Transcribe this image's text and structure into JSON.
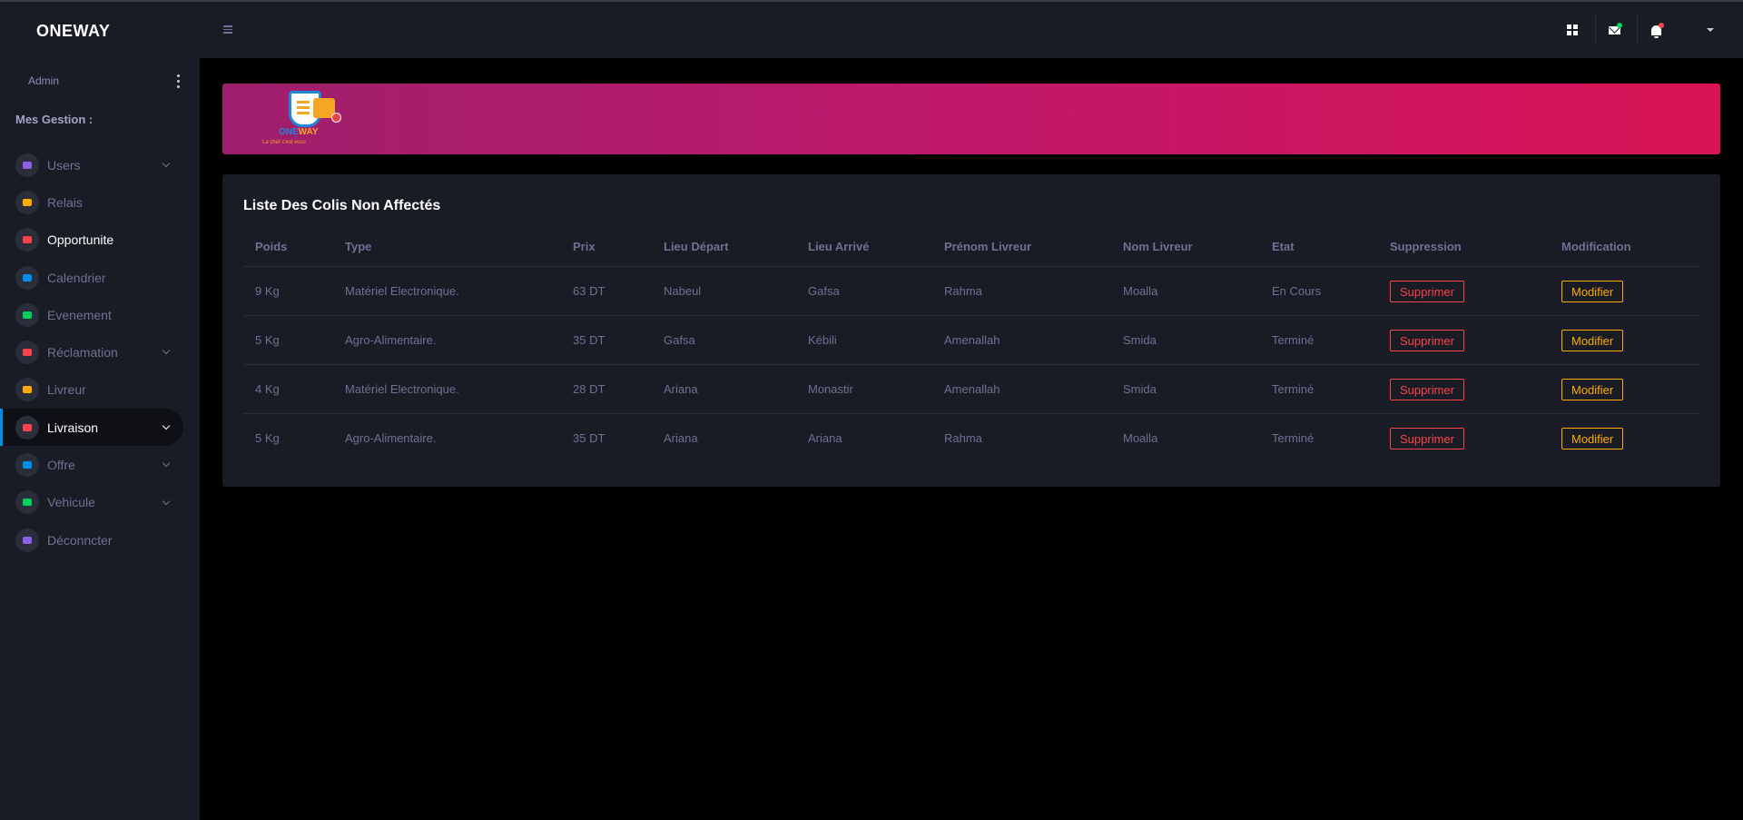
{
  "brand": "ONEWAY",
  "sidebar": {
    "admin_name": "Admin",
    "section_title": "Mes Gestion :",
    "items": [
      {
        "label": "Users",
        "icon": "users-icon",
        "color": "#8f5fe8",
        "chevron": true
      },
      {
        "label": "Relais",
        "icon": "table-icon",
        "color": "#ffab00",
        "chevron": false
      },
      {
        "label": "Opportunite",
        "icon": "message-icon",
        "color": "#fc424a",
        "chevron": false
      },
      {
        "label": "Calendrier",
        "icon": "list-icon",
        "color": "#0090e7",
        "chevron": false
      },
      {
        "label": "Evenement",
        "icon": "grid-icon",
        "color": "#00d25b",
        "chevron": false
      },
      {
        "label": "Réclamation",
        "icon": "file-icon",
        "color": "#fc424a",
        "chevron": true
      },
      {
        "label": "Livreur",
        "icon": "id-card-icon",
        "color": "#ffab00",
        "chevron": false
      },
      {
        "label": "Livraison",
        "icon": "truck-icon",
        "color": "#fc424a",
        "chevron": true,
        "active": true
      },
      {
        "label": "Offre",
        "icon": "tag-icon",
        "color": "#0090e7",
        "chevron": true
      },
      {
        "label": "Vehicule",
        "icon": "truck-icon",
        "color": "#00d25b",
        "chevron": true
      },
      {
        "label": "Déconncter",
        "icon": "contact-icon",
        "color": "#8f5fe8",
        "chevron": false
      }
    ]
  },
  "topbar": {
    "mail_dot_color": "#00d25b",
    "bell_dot_color": "#fc424a"
  },
  "banner": {
    "logo_text_one": "ONE",
    "logo_text_way": "WAY",
    "logo_slogan": "La chef c'est vous"
  },
  "table": {
    "title": "Liste Des Colis Non Affectés",
    "columns": [
      "Poids",
      "Type",
      "Prix",
      "Lieu Départ",
      "Lieu Arrivé",
      "Prénom Livreur",
      "Nom Livreur",
      "Etat",
      "Suppression",
      "Modification"
    ],
    "rows": [
      [
        "9 Kg",
        "Matériel Electronique.",
        "63 DT",
        "Nabeul",
        "Gafsa",
        "Rahma",
        "Moalla",
        "En Cours"
      ],
      [
        "5 Kg",
        "Agro-Alimentaire.",
        "35 DT",
        "Gafsa",
        "Kébili",
        "Amenallah",
        "Smida",
        "Terminé"
      ],
      [
        "4 Kg",
        "Matériel Electronique.",
        "28 DT",
        "Ariana",
        "Monastir",
        "Amenallah",
        "Smida",
        "Terminé"
      ],
      [
        "5 Kg",
        "Agro-Alimentaire.",
        "35 DT",
        "Ariana",
        "Ariana",
        "Rahma",
        "Moalla",
        "Terminé"
      ]
    ],
    "delete_label": "Supprimer",
    "edit_label": "Modifier"
  }
}
